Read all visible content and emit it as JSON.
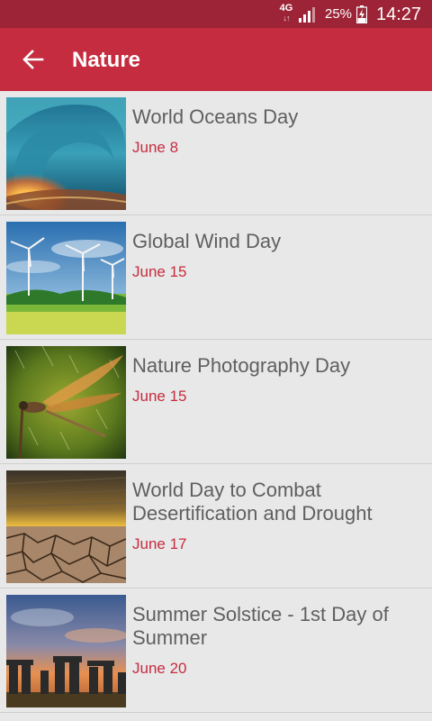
{
  "status_bar": {
    "network": "4G",
    "battery_percent": "25%",
    "time": "14:27"
  },
  "app_bar": {
    "title": "Nature",
    "back_icon": "arrow-left-icon"
  },
  "colors": {
    "status_bar": "#9c2436",
    "app_bar": "#c62c3f",
    "date_text": "#c62c3f",
    "title_text": "#5f5f5f",
    "background": "#e8e8e8"
  },
  "events": [
    {
      "title": "World Oceans Day",
      "date": "June 8",
      "image": "ocean-wave-sunset"
    },
    {
      "title": "Global Wind Day",
      "date": "June 15",
      "image": "wind-turbines-field"
    },
    {
      "title": "Nature Photography Day",
      "date": "June 15",
      "image": "dragonfly-in-rain"
    },
    {
      "title": "World Day to Combat Desertification and Drought",
      "date": "June 17",
      "image": "cracked-desert-earth"
    },
    {
      "title": "Summer Solstice - 1st Day of Summer",
      "date": "June 20",
      "image": "stonehenge-sunset"
    }
  ]
}
